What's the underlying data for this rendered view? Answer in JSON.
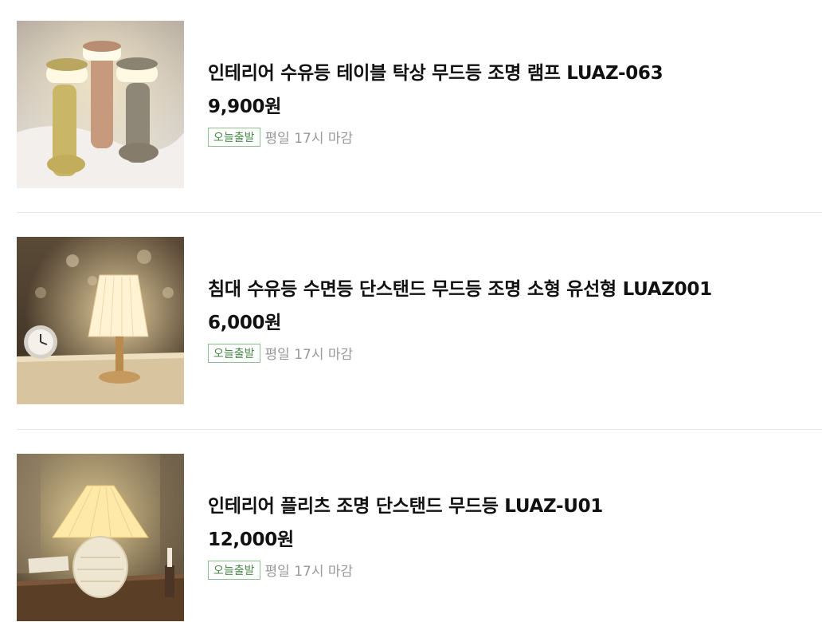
{
  "products": [
    {
      "title": "인테리어 수유등 테이블 탁상 무드등 조명 램프 LUAZ-063",
      "price": "9,900원",
      "badge": "오늘출발",
      "shipping_note": "평일 17시 마감"
    },
    {
      "title": "침대 수유등 수면등 단스탠드 무드등 조명 소형 유선형 LUAZ001",
      "price": "6,000원",
      "badge": "오늘출발",
      "shipping_note": "평일 17시 마감"
    },
    {
      "title": "인테리어 플리츠 조명 단스탠드 무드등 LUAZ-U01",
      "price": "12,000원",
      "badge": "오늘출발",
      "shipping_note": "평일 17시 마감"
    }
  ],
  "colors": {
    "badge_border": "#8dc08d",
    "badge_text": "#4a8b4a",
    "muted_text": "#999999",
    "divider": "#e6e6e6"
  }
}
